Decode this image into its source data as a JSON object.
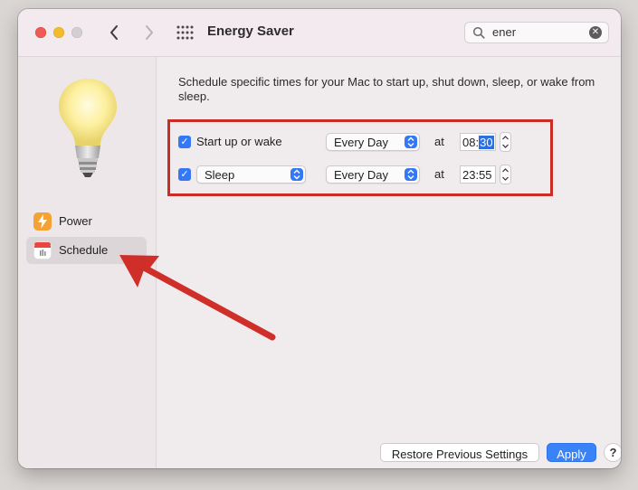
{
  "window": {
    "title": "Energy Saver",
    "controls": [
      "close-icon",
      "minimize-icon",
      "zoom-icon"
    ]
  },
  "toolbar": {
    "back_icon": "chevron-left-icon",
    "forward_icon": "chevron-right-icon",
    "grid_icon": "grid-icon"
  },
  "search": {
    "value": "ener",
    "icon": "search-icon",
    "clear_icon": "clear-icon"
  },
  "sidebar": {
    "header_icon": "lightbulb-icon",
    "items": [
      {
        "label": "Power",
        "icon": "lightning-icon",
        "selected": false
      },
      {
        "label": "Schedule",
        "icon": "calendar-icon",
        "selected": true
      }
    ]
  },
  "main": {
    "description": "Schedule specific times for your Mac to start up, shut down, sleep, or wake from sleep.",
    "rows": [
      {
        "checked": true,
        "label": "Start up or wake",
        "frequency": "Every Day",
        "at": "at",
        "time_hours": "08",
        "time_sep": ":",
        "time_minutes": "30"
      },
      {
        "checked": true,
        "action": "Sleep",
        "frequency": "Every Day",
        "at": "at",
        "time": "23:55"
      }
    ]
  },
  "footer": {
    "restore_label": "Restore Previous Settings",
    "apply_label": "Apply",
    "help_label": "?"
  },
  "colors": {
    "accent": "#3478f6",
    "annotation": "#cc2c26"
  }
}
